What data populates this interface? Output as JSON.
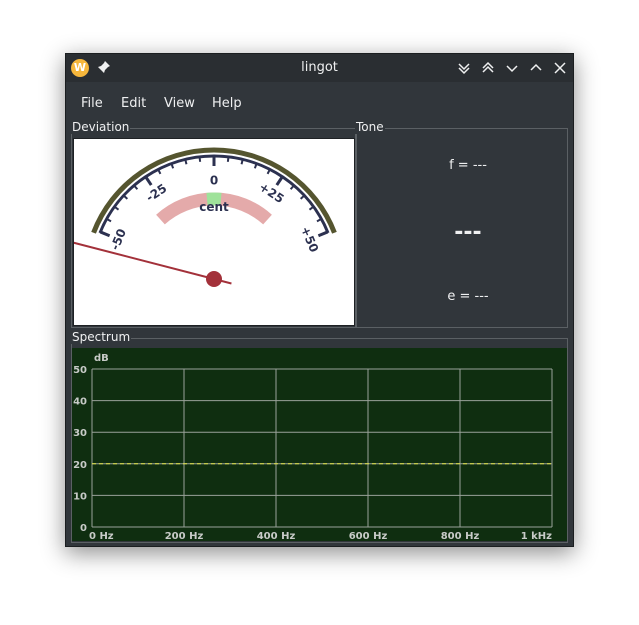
{
  "window": {
    "title": "lingot",
    "app_icon_letter": "W"
  },
  "menu": [
    "File",
    "Edit",
    "View",
    "Help"
  ],
  "deviation": {
    "label": "Deviation",
    "unit": "cent",
    "scale_labels": [
      "-50",
      "-25",
      "0",
      "+25",
      "+50"
    ],
    "needle_value": -50
  },
  "tone": {
    "label": "Tone",
    "frequency": "f = ---",
    "note": "---",
    "error": "e = ---"
  },
  "spectrum": {
    "label": "Spectrum",
    "ylabel": "dB",
    "y_ticks": [
      "0",
      "10",
      "20",
      "30",
      "40",
      "50"
    ],
    "x_ticks": [
      "0 Hz",
      "200 Hz",
      "400 Hz",
      "600 Hz",
      "800 Hz",
      "1 kHz"
    ],
    "threshold_db": 20
  },
  "colors": {
    "spectrum_bg": "#0f2e10",
    "grid": "#9aa29a",
    "threshold": "#e8e84a",
    "needle": "#a3313a",
    "ok_zone": "#9fe29a",
    "tolerance_arc": "#e4aaaa"
  }
}
